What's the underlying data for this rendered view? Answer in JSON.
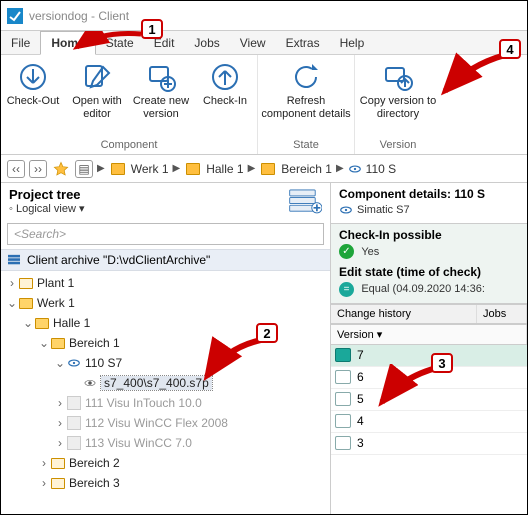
{
  "title": "versiondog - Client",
  "menu": {
    "items": [
      "File",
      "Home",
      "State",
      "Edit",
      "Jobs",
      "View",
      "Extras",
      "Help"
    ],
    "active": 1
  },
  "ribbon": {
    "groups": [
      {
        "label": "Component",
        "buttons": [
          {
            "id": "check-out",
            "label": "Check-Out"
          },
          {
            "id": "open-editor",
            "label": "Open with editor"
          },
          {
            "id": "create-ver",
            "label": "Create new version"
          },
          {
            "id": "check-in",
            "label": "Check-In"
          }
        ]
      },
      {
        "label": "State",
        "buttons": [
          {
            "id": "refresh",
            "label": "Refresh component details"
          }
        ]
      },
      {
        "label": "Version",
        "buttons": [
          {
            "id": "copy-dir",
            "label": "Copy version to directory"
          }
        ]
      }
    ]
  },
  "breadcrumb": {
    "items": [
      "Werk 1",
      "Halle 1",
      "Bereich 1",
      "110 S"
    ]
  },
  "left": {
    "title": "Project tree",
    "view_toggle": "Logical view",
    "search_placeholder": "<Search>",
    "archive": "Client archive \"D:\\vdClientArchive\"",
    "tree": {
      "plant1": "Plant 1",
      "werk1": "Werk 1",
      "halle1": "Halle 1",
      "bereich1": "Bereich 1",
      "n110": "110 S7",
      "sel": "s7_400\\s7_400.s7p",
      "n111": "111 Visu InTouch 10.0",
      "n112": "112 Visu WinCC Flex 2008",
      "n113": "113 Visu WinCC 7.0",
      "bereich2": "Bereich 2",
      "bereich3": "Bereich 3"
    }
  },
  "right": {
    "details_title": "Component details: 110 S",
    "details_sub": "Simatic S7",
    "checkin_title": "Check-In possible",
    "checkin_value": "Yes",
    "editstate_title": "Edit state (time of check)",
    "editstate_value": "Equal (04.09.2020 14:36:",
    "history_label": "Change history",
    "jobs_label": "Jobs",
    "version_col": "Version",
    "versions": [
      "7",
      "6",
      "5",
      "4",
      "3"
    ]
  },
  "callouts": {
    "c1": "1",
    "c2": "2",
    "c3": "3",
    "c4": "4"
  }
}
